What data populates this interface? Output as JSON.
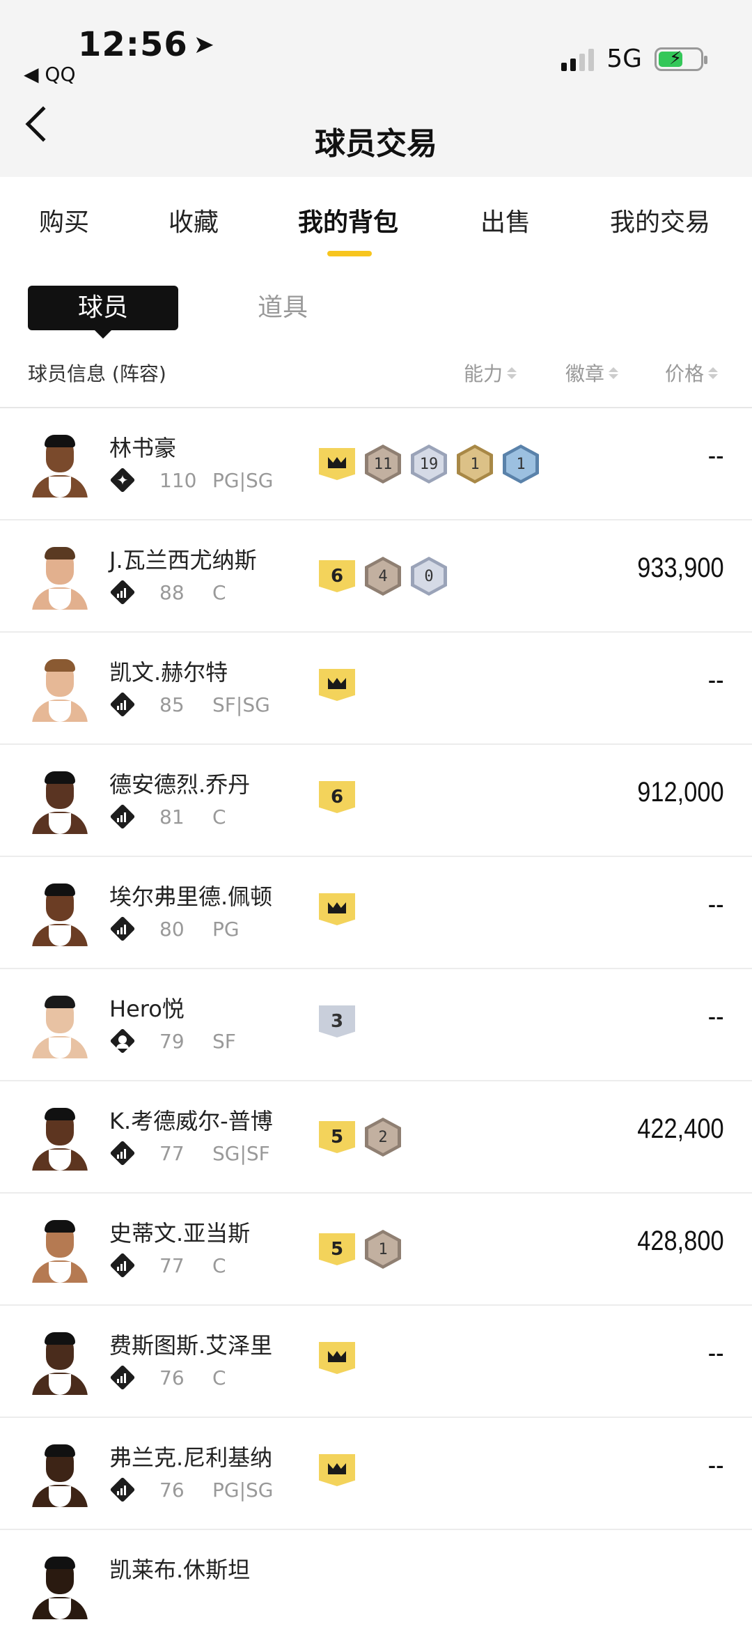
{
  "status_bar": {
    "time": "12:56",
    "back_app": "◀ QQ",
    "network": "5G"
  },
  "header": {
    "title": "球员交易"
  },
  "tabs": [
    {
      "label": "购买",
      "active": false
    },
    {
      "label": "收藏",
      "active": false
    },
    {
      "label": "我的背包",
      "active": true
    },
    {
      "label": "出售",
      "active": false
    },
    {
      "label": "我的交易",
      "active": false
    }
  ],
  "subtabs": [
    {
      "label": "球员",
      "active": true
    },
    {
      "label": "道具",
      "active": false
    }
  ],
  "columns": {
    "info": "球员信息 (阵容)",
    "ability": "能力",
    "badge": "徽章",
    "price": "价格"
  },
  "colors": {
    "accent": "#f7c51e",
    "tier_gold": "#f3d35b",
    "tier_silver": "#c9cfdb"
  },
  "players": [
    {
      "name": "林书豪",
      "type": "star-icon",
      "rating": "110",
      "position": "PG|SG",
      "tier": "crown",
      "badges": [
        {
          "value": "11",
          "color": "bronze"
        },
        {
          "value": "19",
          "color": "silver"
        },
        {
          "value": "1",
          "color": "gold"
        },
        {
          "value": "1",
          "color": "blue"
        }
      ],
      "price": "--"
    },
    {
      "name": "J.瓦兰西尤纳斯",
      "type": "bars-icon",
      "rating": "88",
      "position": "C",
      "tier": "6",
      "badges": [
        {
          "value": "4",
          "color": "bronze"
        },
        {
          "value": "0",
          "color": "silver"
        }
      ],
      "price": "933,900"
    },
    {
      "name": "凯文.赫尔特",
      "type": "bars-icon",
      "rating": "85",
      "position": "SF|SG",
      "tier": "crown",
      "badges": [],
      "price": "--"
    },
    {
      "name": "德安德烈.乔丹",
      "type": "bars-icon",
      "rating": "81",
      "position": "C",
      "tier": "6",
      "badges": [],
      "price": "912,000"
    },
    {
      "name": "埃尔弗里德.佩顿",
      "type": "bars-icon",
      "rating": "80",
      "position": "PG",
      "tier": "crown",
      "badges": [],
      "price": "--"
    },
    {
      "name": "Hero悦",
      "type": "person-icon",
      "rating": "79",
      "position": "SF",
      "tier": "3",
      "tier_style": "grey",
      "badges": [],
      "price": "--"
    },
    {
      "name": "K.考德威尔-普博",
      "type": "bars-icon",
      "rating": "77",
      "position": "SG|SF",
      "tier": "5",
      "badges": [
        {
          "value": "2",
          "color": "bronze"
        }
      ],
      "price": "422,400"
    },
    {
      "name": "史蒂文.亚当斯",
      "type": "bars-icon",
      "rating": "77",
      "position": "C",
      "tier": "5",
      "badges": [
        {
          "value": "1",
          "color": "bronze"
        }
      ],
      "price": "428,800"
    },
    {
      "name": "费斯图斯.艾泽里",
      "type": "bars-icon",
      "rating": "76",
      "position": "C",
      "tier": "crown",
      "badges": [],
      "price": "--"
    },
    {
      "name": "弗兰克.尼利基纳",
      "type": "bars-icon",
      "rating": "76",
      "position": "PG|SG",
      "tier": "crown",
      "badges": [],
      "price": "--"
    },
    {
      "name": "凯莱布.休斯坦",
      "type": "bars-icon",
      "rating": "",
      "position": "",
      "tier": "",
      "badges": [],
      "price": ""
    }
  ]
}
